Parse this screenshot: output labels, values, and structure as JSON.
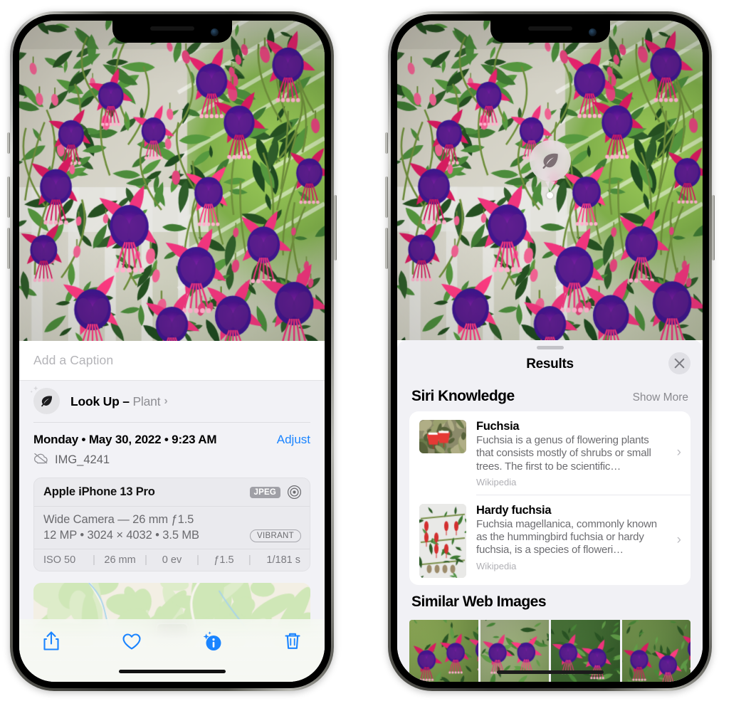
{
  "colors": {
    "accent_blue": "#1a84ff",
    "sheet_bg": "#f1f1f5",
    "card_bg": "#ffffff",
    "secondary_text": "#6c6c70",
    "badge_gray": "#a0a0a6"
  },
  "left_phone": {
    "caption": {
      "placeholder": "Add a Caption",
      "value": ""
    },
    "look_up": {
      "label": "Look Up",
      "dash": " – ",
      "subject": "Plant",
      "chevron": "›",
      "icon": "leaf-icon"
    },
    "date_row": {
      "date": "Monday • May 30, 2022 • 9:23 AM",
      "adjust_label": "Adjust"
    },
    "filename_row": {
      "icon": "cloud-slash-icon",
      "filename": "IMG_4241"
    },
    "camera_card": {
      "model": "Apple iPhone 13 Pro",
      "format_badge": "JPEG",
      "aperture_icon": "aperture-icon",
      "lens_line": "Wide Camera — 26 mm ƒ1.5",
      "spec_line": "12 MP • 3024 × 4032 • 3.5 MB",
      "style_badge": "VIBRANT",
      "exif": [
        {
          "label": "ISO 50"
        },
        {
          "label": "26 mm"
        },
        {
          "label": "0 ev"
        },
        {
          "label": "ƒ1.5"
        },
        {
          "label": "1/181 s"
        }
      ],
      "exif_separator": "|"
    },
    "toolbar": {
      "items": [
        {
          "name": "share-icon",
          "label": "Share"
        },
        {
          "name": "heart-icon",
          "label": "Favorite"
        },
        {
          "name": "info-sparkle-icon",
          "label": "Info"
        },
        {
          "name": "trash-icon",
          "label": "Delete"
        }
      ]
    }
  },
  "right_phone": {
    "leaf_badge": {
      "icon": "leaf-icon",
      "label": "Plant detected"
    },
    "sheet": {
      "title": "Results",
      "close_label": "✕",
      "grabber": "drag-handle"
    },
    "siri_knowledge": {
      "title": "Siri Knowledge",
      "action": "Show More",
      "items": [
        {
          "title": "Fuchsia",
          "description": "Fuchsia is a genus of flowering plants that consists mostly of shrubs or small trees. The first to be scientific…",
          "source": "Wikipedia",
          "chevron": "›",
          "thumb": "fuchsia-red-flowers"
        },
        {
          "title": "Hardy fuchsia",
          "description": "Fuchsia magellanica, commonly known as the hummingbird fuchsia or hardy fuchsia, is a species of floweri…",
          "source": "Wikipedia",
          "chevron": "›",
          "thumb": "hardy-fuchsia-branch"
        }
      ]
    },
    "similar_web_images": {
      "title": "Similar Web Images",
      "items": [
        {
          "alt": "pink-white-fuchsia-leaves"
        },
        {
          "alt": "red-fuchsia-closeup"
        },
        {
          "alt": "fuchsia-bush-buds"
        },
        {
          "alt": "purple-magenta-fuchsia"
        }
      ]
    }
  }
}
